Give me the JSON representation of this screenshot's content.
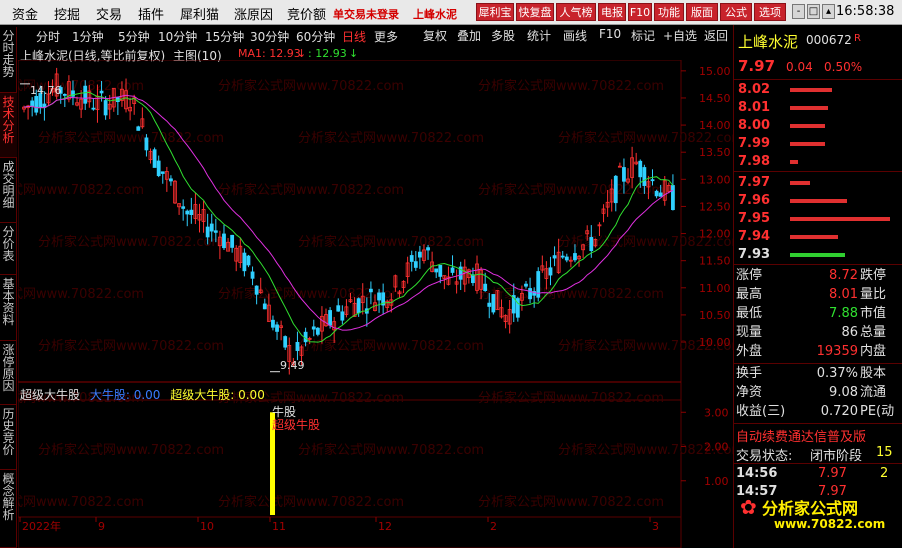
{
  "menu": {
    "items": [
      "资金",
      "挖掘",
      "交易",
      "插件",
      "犀利猫",
      "涨原因",
      "竞价额"
    ],
    "notice": "单交易未登录",
    "stock_name": "上峰水泥",
    "buttons": [
      "犀利宝",
      "快复盘",
      "人气榜",
      "电报",
      "F10",
      "功能",
      "版面",
      "公式",
      "选项"
    ],
    "clock": "16:58:38",
    "win_controls": [
      "-",
      "□",
      "×"
    ]
  },
  "left_tabs": [
    "分时走势",
    "技术分析",
    "成交明细",
    "分价表",
    "基本资料",
    "涨停原因",
    "历史竞价",
    "概念解析"
  ],
  "timeframes": [
    "分时",
    "1分钟",
    "5分钟",
    "10分钟",
    "15分钟",
    "30分钟",
    "60分钟",
    "日线",
    "更多"
  ],
  "tools": [
    "复权",
    "叠加",
    "多股",
    "统计",
    "画线",
    "F10",
    "标记",
    "+自选",
    "返回"
  ],
  "chart_header": {
    "title": "上峰水泥(日线,等比前复权)",
    "main_label": "主图(10)",
    "ma_label": "MA1: 12.93",
    "ma_value": ": 12.93"
  },
  "annotations": {
    "high": "14.76",
    "low": "9.49"
  },
  "indicator": {
    "name": "超级大牛股",
    "series1_label": "大牛股: 0.00",
    "series2_label": "超级大牛股: 0.00",
    "bar_label_1": "牛股",
    "bar_label_2": "超级牛股"
  },
  "chart_data": {
    "type": "candlestick",
    "y_ticks_main": [
      "15.00",
      "14.50",
      "14.00",
      "13.50",
      "13.00",
      "12.50",
      "12.00",
      "11.50",
      "11.00",
      "10.50",
      "10.00"
    ],
    "y_ticks_indicator": [
      "3.00",
      "2.00",
      "1.00"
    ],
    "x_labels": [
      "2022年",
      "9",
      "10",
      "11",
      "12",
      "2",
      "3"
    ],
    "ylim_main": [
      9.3,
      15.2
    ],
    "high": 14.76,
    "low": 9.49,
    "ma1": 12.93,
    "signal": {
      "date_label": "11",
      "value": 3.0
    }
  },
  "quote": {
    "name": "上峰水泥",
    "code": "000672",
    "badge": "R",
    "price": "7.97",
    "change": "0.04",
    "change_pct": "0.50%",
    "asks": [
      {
        "price": "8.02",
        "vol": 0.42
      },
      {
        "price": "8.01",
        "vol": 0.38
      },
      {
        "price": "8.00",
        "vol": 0.35
      },
      {
        "price": "7.99",
        "vol": 0.35
      },
      {
        "price": "7.98",
        "vol": 0.08
      }
    ],
    "bids": [
      {
        "price": "7.97",
        "vol": 0.2
      },
      {
        "price": "7.96",
        "vol": 0.57
      },
      {
        "price": "7.95",
        "vol": 1.0
      },
      {
        "price": "7.94",
        "vol": 0.48
      },
      {
        "price": "7.93",
        "vol": 0.55
      }
    ],
    "stats": [
      {
        "label": "涨停",
        "value": "8.72",
        "label2": "跌停",
        "color": "#ff3030"
      },
      {
        "label": "最高",
        "value": "8.01",
        "label2": "量比",
        "color": "#ff3030"
      },
      {
        "label": "最低",
        "value": "7.88",
        "label2": "市值",
        "color": "#30e030"
      },
      {
        "label": "现量",
        "value": "86",
        "label2": "总量",
        "color": "#e0e0e0"
      },
      {
        "label": "外盘",
        "value": "19359",
        "label2": "内盘",
        "color": "#ff3030"
      }
    ],
    "stats2": [
      {
        "label": "换手",
        "value": "0.37%",
        "label2": "股本"
      },
      {
        "label": "净资",
        "value": "9.08",
        "label2": "流通"
      },
      {
        "label": "收益(三)",
        "value": "0.720",
        "label2": "PE(动"
      }
    ],
    "scroll_text": "自动续费通达信普及版",
    "status_label": "交易状态:",
    "status_value": "闭市阶段",
    "status_num": "15",
    "ticks": [
      {
        "time": "14:56",
        "price": "7.97",
        "vol": "2"
      },
      {
        "time": "14:57",
        "price": "7.97",
        "vol": ""
      }
    ]
  },
  "watermark": {
    "site": "分析家公式网",
    "url": "www.70822.com"
  }
}
